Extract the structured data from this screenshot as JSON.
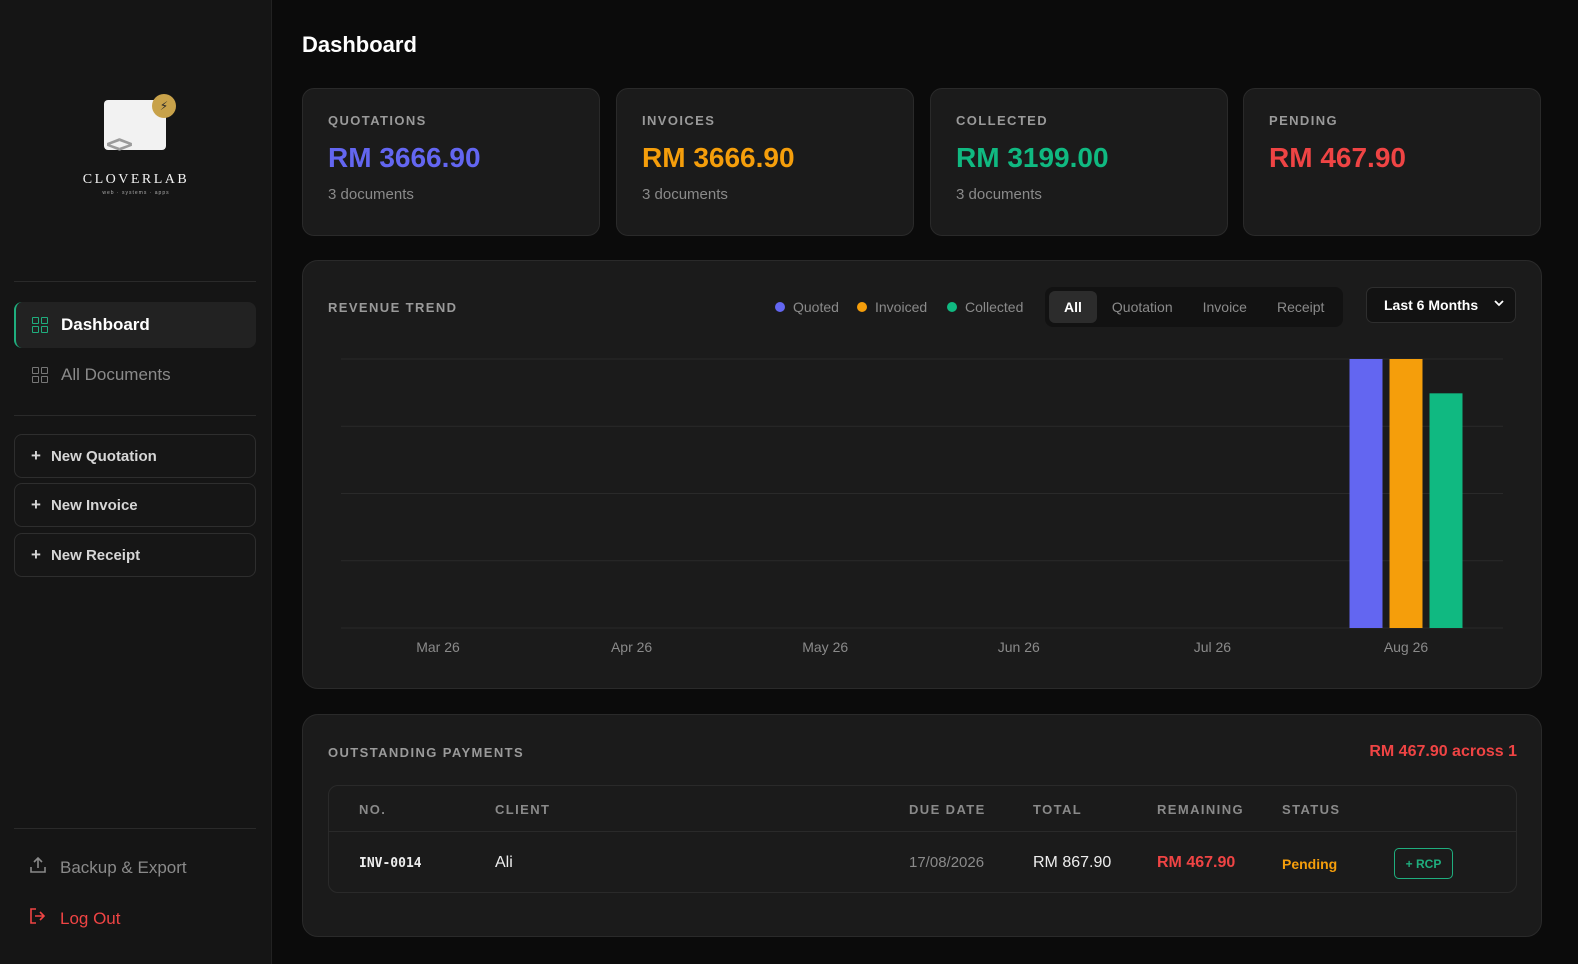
{
  "brand": {
    "name": "CLOVERLAB",
    "tagline": "web · systems · apps"
  },
  "colors": {
    "quoted": "#6366f1",
    "invoiced": "#f59e0b",
    "collected": "#10b981",
    "pending": "#ef4444",
    "accent": "#1fae7e"
  },
  "sidebar": {
    "nav": [
      {
        "label": "Dashboard",
        "icon": "dashboard-grid-icon",
        "active": true
      },
      {
        "label": "All Documents",
        "icon": "documents-grid-icon",
        "active": false
      }
    ],
    "actions": [
      {
        "label": "New Quotation",
        "icon": "plus-icon"
      },
      {
        "label": "New Invoice",
        "icon": "plus-icon"
      },
      {
        "label": "New Receipt",
        "icon": "plus-icon"
      }
    ],
    "backup_label": "Backup & Export",
    "logout_label": "Log Out"
  },
  "page": {
    "title": "Dashboard"
  },
  "stats": [
    {
      "label": "QUOTATIONS",
      "value": "RM 3666.90",
      "sub": "3 documents",
      "color": "#6366f1"
    },
    {
      "label": "INVOICES",
      "value": "RM 3666.90",
      "sub": "3 documents",
      "color": "#f59e0b"
    },
    {
      "label": "COLLECTED",
      "value": "RM 3199.00",
      "sub": "3 documents",
      "color": "#10b981"
    },
    {
      "label": "PENDING",
      "value": "RM 467.90",
      "sub": "",
      "color": "#ef4444"
    }
  ],
  "revenue": {
    "title": "REVENUE TREND",
    "legend": [
      "Quoted",
      "Invoiced",
      "Collected"
    ],
    "filters": [
      "All",
      "Quotation",
      "Invoice",
      "Receipt"
    ],
    "active_filter": "All",
    "range": "Last 6 Months"
  },
  "chart_data": {
    "type": "bar",
    "categories": [
      "Mar 26",
      "Apr 26",
      "May 26",
      "Jun 26",
      "Jul 26",
      "Aug 26"
    ],
    "series": [
      {
        "name": "Quoted",
        "values": [
          0,
          0,
          0,
          0,
          0,
          3666.9
        ]
      },
      {
        "name": "Invoiced",
        "values": [
          0,
          0,
          0,
          0,
          0,
          3666.9
        ]
      },
      {
        "name": "Collected",
        "values": [
          0,
          0,
          0,
          0,
          0,
          3199.0
        ]
      }
    ],
    "ylim": [
      0,
      3666.9
    ],
    "grid": true,
    "legend": "top-right"
  },
  "outstanding": {
    "title": "OUTSTANDING PAYMENTS",
    "summary": "RM 467.90 across 1",
    "columns": [
      "NO.",
      "CLIENT",
      "DUE DATE",
      "TOTAL",
      "REMAINING",
      "STATUS"
    ],
    "rows": [
      {
        "no": "INV-0014",
        "client": "Ali",
        "due": "17/08/2026",
        "total": "RM 867.90",
        "remaining": "RM 467.90",
        "status": "Pending",
        "action": "+ RCP"
      }
    ]
  }
}
